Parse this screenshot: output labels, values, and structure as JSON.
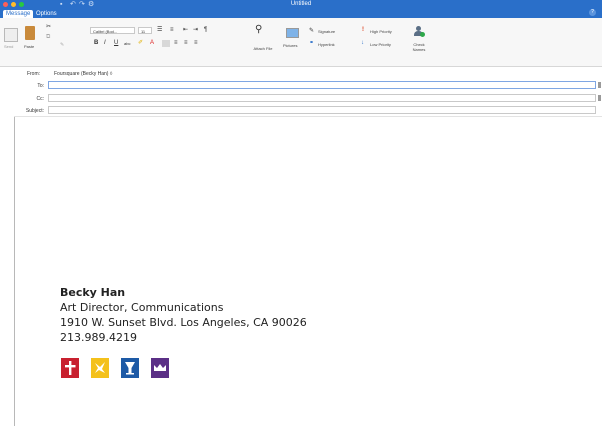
{
  "window": {
    "title": "Untitled",
    "icons": [
      "save-icon",
      "undo-icon",
      "redo-icon",
      "format-icon"
    ]
  },
  "tabs": [
    {
      "label": "Message",
      "active": true
    },
    {
      "label": "Options",
      "active": false
    }
  ],
  "ribbon": {
    "send_label": "Send",
    "paste_label": "Paste",
    "font_name": "Calibri (Bod...",
    "font_size": "11",
    "attach_label": "Attach File",
    "pictures_label": "Pictures",
    "signature_label": "Signature",
    "hyperlink_label": "Hyperlink",
    "high_priority_label": "High Priority",
    "low_priority_label": "Low Priority",
    "check_names_label": "Check Names"
  },
  "compose": {
    "from_label": "From:",
    "from_value": "Foursquare (Becky Han) ◊",
    "to_label": "To:",
    "cc_label": "Cc:",
    "subject_label": "Subject:"
  },
  "signature": {
    "name": "Becky Han",
    "title": "Art Director, Communications",
    "address": "1910 W. Sunset Blvd. Los Angeles, CA 90026",
    "phone": "213.989.4219"
  },
  "colors": {
    "titlebar": "#2a6fc9",
    "logo_red": "#c8202f",
    "logo_yellow": "#f4c11b",
    "logo_blue": "#1d5aa6",
    "logo_purple": "#5b2f86"
  }
}
